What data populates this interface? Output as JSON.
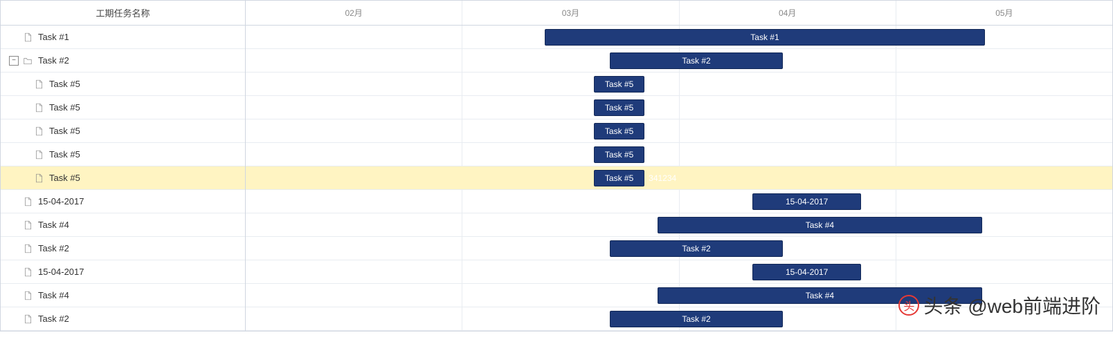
{
  "chart_data": {
    "type": "gantt",
    "x_axis": {
      "unit": "month",
      "start": "2017-02",
      "end": "2017-05",
      "ticks": [
        "02月",
        "03月",
        "04月",
        "05月"
      ]
    },
    "tasks": [
      {
        "id": 1,
        "name": "Task #1",
        "start": "2017-02-28",
        "end": "2017-04-30",
        "level": 0,
        "type": "task"
      },
      {
        "id": 2,
        "name": "Task #2",
        "start": "2017-03-09",
        "end": "2017-04-01",
        "level": 0,
        "type": "project",
        "expanded": true
      },
      {
        "id": 3,
        "name": "Task #5",
        "start": "2017-03-06",
        "end": "2017-03-12",
        "level": 1,
        "type": "task",
        "parent": 2
      },
      {
        "id": 4,
        "name": "Task #5",
        "start": "2017-03-06",
        "end": "2017-03-12",
        "level": 1,
        "type": "task",
        "parent": 2
      },
      {
        "id": 5,
        "name": "Task #5",
        "start": "2017-03-06",
        "end": "2017-03-12",
        "level": 1,
        "type": "task",
        "parent": 2
      },
      {
        "id": 6,
        "name": "Task #5",
        "start": "2017-03-06",
        "end": "2017-03-12",
        "level": 1,
        "type": "task",
        "parent": 2
      },
      {
        "id": 7,
        "name": "Task #5",
        "start": "2017-03-06",
        "end": "2017-03-12",
        "level": 1,
        "type": "task",
        "parent": 2,
        "highlighted": true,
        "side_text": "341234"
      },
      {
        "id": 8,
        "name": "15-04-2017",
        "start": "2017-04-01",
        "end": "2017-04-15",
        "level": 0,
        "type": "task"
      },
      {
        "id": 9,
        "name": "Task #4",
        "start": "2017-03-15",
        "end": "2017-04-28",
        "level": 0,
        "type": "task"
      },
      {
        "id": 10,
        "name": "Task #2",
        "start": "2017-03-09",
        "end": "2017-04-01",
        "level": 0,
        "type": "task"
      },
      {
        "id": 11,
        "name": "15-04-2017",
        "start": "2017-04-01",
        "end": "2017-04-15",
        "level": 0,
        "type": "task"
      },
      {
        "id": 12,
        "name": "Task #4",
        "start": "2017-03-15",
        "end": "2017-04-28",
        "level": 0,
        "type": "task"
      },
      {
        "id": 13,
        "name": "Task #2",
        "start": "2017-03-09",
        "end": "2017-04-01",
        "level": 0,
        "type": "task"
      }
    ]
  },
  "grid": {
    "column_header": "工期任务名称"
  },
  "timeline": {
    "months": [
      "02月",
      "03月",
      "04月",
      "05月"
    ],
    "bars": [
      {
        "left_pct": 34.5,
        "width_pct": 50.8,
        "label": "Task #1"
      },
      {
        "left_pct": 42.0,
        "width_pct": 20.0,
        "label": "Task #2"
      },
      {
        "left_pct": 40.2,
        "width_pct": 5.8,
        "label": "Task #5"
      },
      {
        "left_pct": 40.2,
        "width_pct": 5.8,
        "label": "Task #5"
      },
      {
        "left_pct": 40.2,
        "width_pct": 5.8,
        "label": "Task #5"
      },
      {
        "left_pct": 40.2,
        "width_pct": 5.8,
        "label": "Task #5"
      },
      {
        "left_pct": 40.2,
        "width_pct": 5.8,
        "label": "Task #5",
        "side_text": "341234",
        "side_left_pct": 46.5
      },
      {
        "left_pct": 58.5,
        "width_pct": 12.5,
        "label": "15-04-2017"
      },
      {
        "left_pct": 47.5,
        "width_pct": 37.5,
        "label": "Task #4"
      },
      {
        "left_pct": 42.0,
        "width_pct": 20.0,
        "label": "Task #2"
      },
      {
        "left_pct": 58.5,
        "width_pct": 12.5,
        "label": "15-04-2017"
      },
      {
        "left_pct": 47.5,
        "width_pct": 37.5,
        "label": "Task #4"
      },
      {
        "left_pct": 42.0,
        "width_pct": 20.0,
        "label": "Task #2"
      }
    ]
  },
  "watermark": {
    "text": "头条 @web前端进阶"
  }
}
